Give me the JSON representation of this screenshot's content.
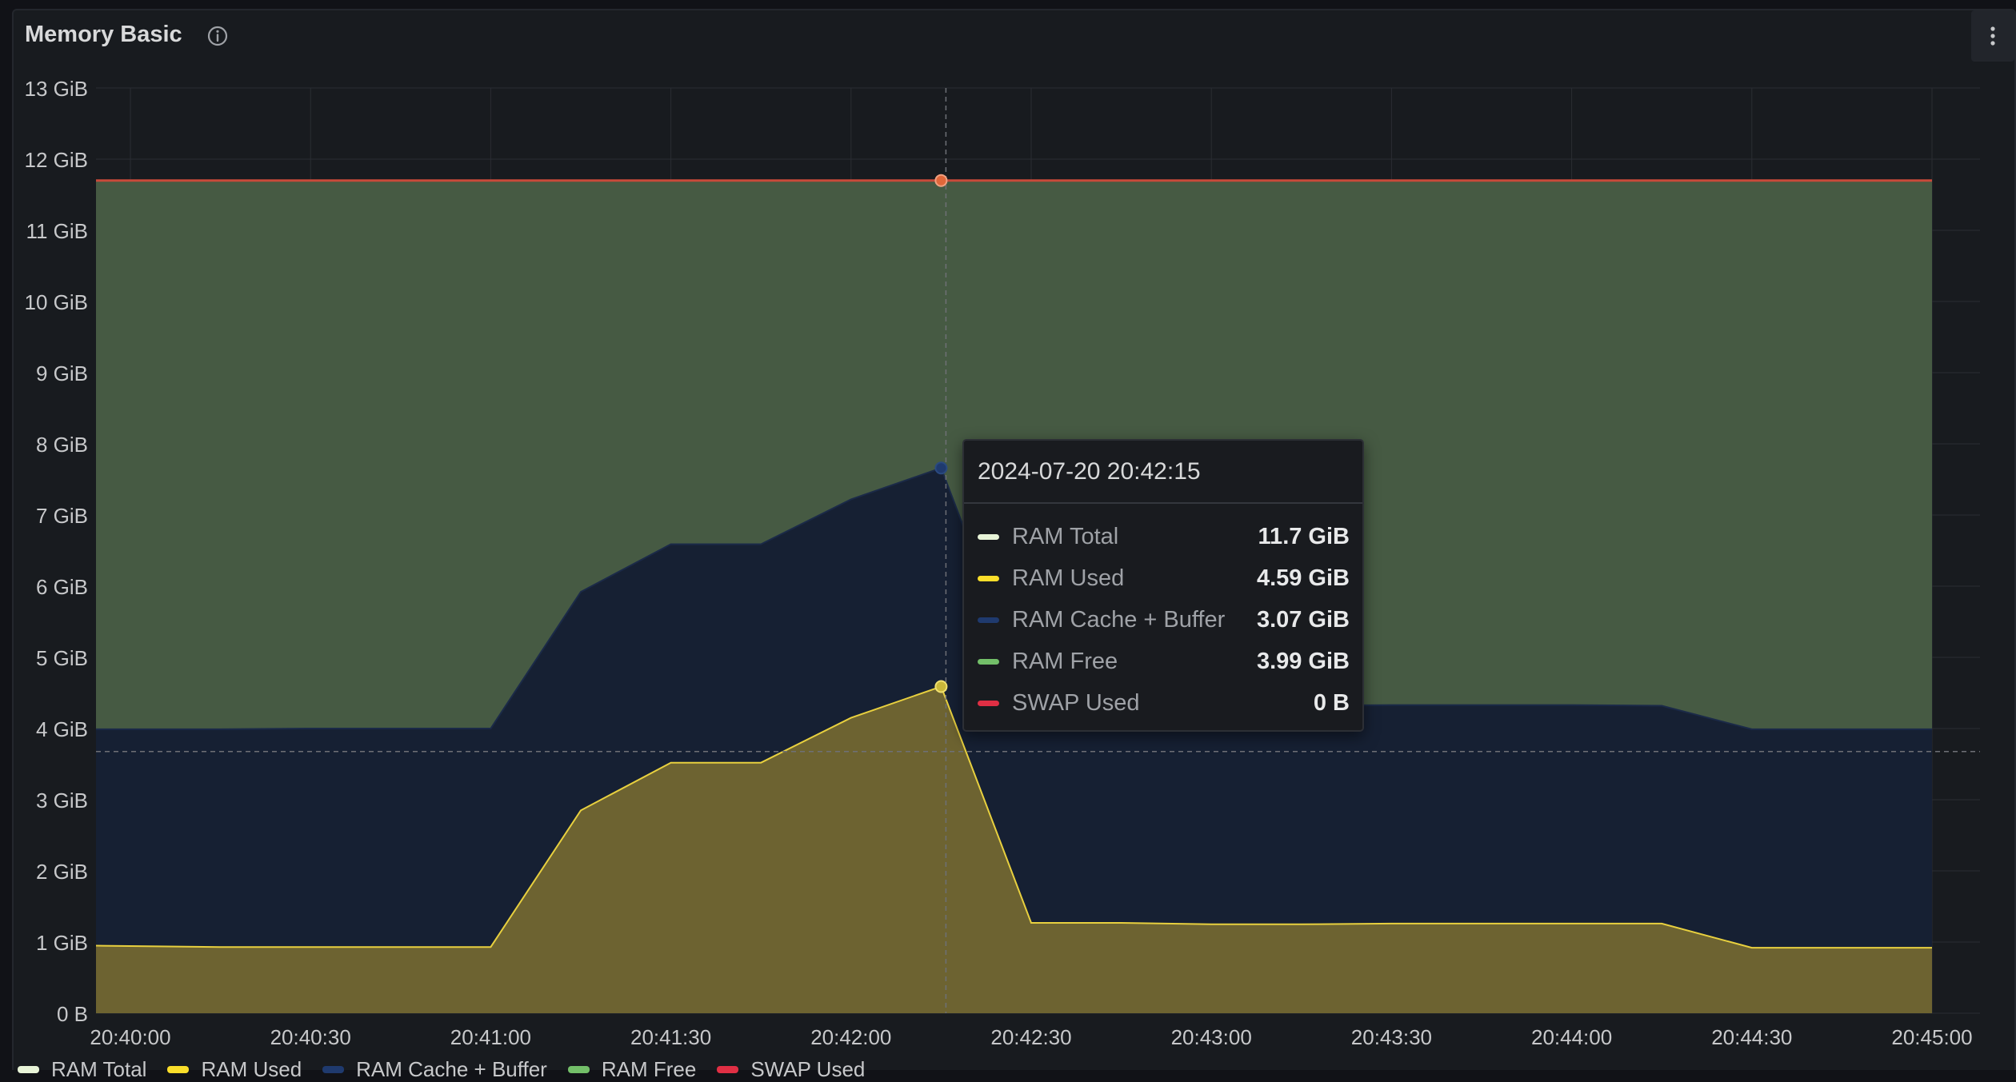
{
  "panel": {
    "title": "Memory Basic",
    "info_icon": "info-circle-icon",
    "menu_icon": "kebab-menu-icon"
  },
  "chart_data": {
    "type": "area",
    "x": [
      "20:40:00",
      "20:40:15",
      "20:40:30",
      "20:40:45",
      "20:41:00",
      "20:41:15",
      "20:41:30",
      "20:41:45",
      "20:42:00",
      "20:42:15",
      "20:42:30",
      "20:42:45",
      "20:43:00",
      "20:43:15",
      "20:43:30",
      "20:43:45",
      "20:44:00",
      "20:44:15",
      "20:44:30",
      "20:44:45",
      "20:45:00"
    ],
    "x_tick_labels": [
      "20:40:00",
      "20:40:30",
      "20:41:00",
      "20:41:30",
      "20:42:00",
      "20:42:30",
      "20:43:00",
      "20:43:30",
      "20:44:00",
      "20:44:30",
      "20:45:00"
    ],
    "y_tick_labels": [
      "0 B",
      "1 GiB",
      "2 GiB",
      "3 GiB",
      "4 GiB",
      "5 GiB",
      "6 GiB",
      "7 GiB",
      "8 GiB",
      "9 GiB",
      "10 GiB",
      "11 GiB",
      "12 GiB",
      "13 GiB"
    ],
    "ylim": [
      0,
      13
    ],
    "y_unit": "GiB",
    "stacked": true,
    "grid": true,
    "legend_position": "bottom",
    "series": [
      {
        "name": "RAM Total",
        "color": "#e8f4d8",
        "values": [
          11.7,
          11.7,
          11.7,
          11.7,
          11.7,
          11.7,
          11.7,
          11.7,
          11.7,
          11.7,
          11.7,
          11.7,
          11.7,
          11.7,
          11.7,
          11.7,
          11.7,
          11.7,
          11.7,
          11.7,
          11.7
        ]
      },
      {
        "name": "RAM Used",
        "color": "#fade2a",
        "values": [
          0.95,
          0.93,
          0.93,
          0.93,
          0.93,
          2.85,
          3.52,
          3.52,
          4.15,
          4.59,
          1.27,
          1.27,
          1.25,
          1.25,
          1.26,
          1.26,
          1.26,
          1.26,
          0.92,
          0.92,
          0.92
        ]
      },
      {
        "name": "RAM Cache + Buffer",
        "color": "#1f3a6e",
        "values": [
          3.04,
          3.06,
          3.07,
          3.07,
          3.07,
          3.07,
          3.07,
          3.07,
          3.07,
          3.07,
          3.07,
          3.07,
          3.07,
          3.07,
          3.07,
          3.07,
          3.07,
          3.06,
          3.07,
          3.07,
          3.07
        ]
      },
      {
        "name": "RAM Free",
        "color": "#73bf69",
        "values": [
          7.71,
          7.71,
          7.7,
          7.7,
          7.7,
          5.78,
          5.11,
          5.11,
          4.48,
          4.04,
          7.36,
          7.36,
          7.38,
          7.38,
          7.37,
          7.37,
          7.37,
          7.38,
          7.71,
          7.71,
          7.71
        ]
      },
      {
        "name": "SWAP Used",
        "color": "#e02f44",
        "values": [
          0,
          0,
          0,
          0,
          0,
          0,
          0,
          0,
          0,
          0,
          0,
          0,
          0,
          0,
          0,
          0,
          0,
          0,
          0,
          0,
          0
        ]
      }
    ],
    "hover_index": 9
  },
  "tooltip": {
    "time": "2024-07-20 20:42:15",
    "rows": [
      {
        "name": "RAM Total",
        "value": "11.7 GiB",
        "color": "#e8f4d8"
      },
      {
        "name": "RAM Used",
        "value": "4.59 GiB",
        "color": "#fade2a"
      },
      {
        "name": "RAM Cache + Buffer",
        "value": "3.07 GiB",
        "color": "#1f3a6e"
      },
      {
        "name": "RAM Free",
        "value": "3.99 GiB",
        "color": "#73bf69"
      },
      {
        "name": "SWAP Used",
        "value": "0 B",
        "color": "#e02f44"
      }
    ]
  },
  "legend": [
    {
      "label": "RAM Total",
      "color": "#e8f4d8"
    },
    {
      "label": "RAM Used",
      "color": "#fade2a"
    },
    {
      "label": "RAM Cache + Buffer",
      "color": "#1f3a6e"
    },
    {
      "label": "RAM Free",
      "color": "#73bf69"
    },
    {
      "label": "SWAP Used",
      "color": "#e02f44"
    }
  ]
}
